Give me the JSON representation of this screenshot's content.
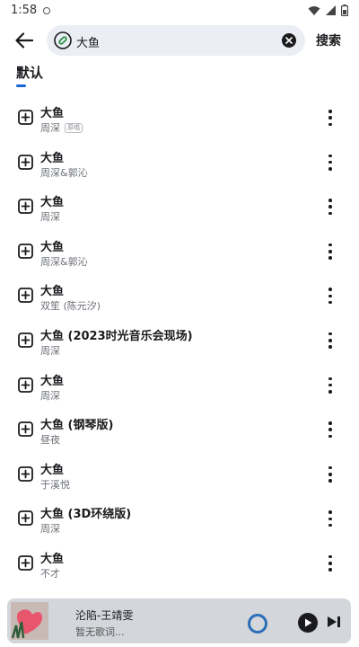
{
  "status_bar": {
    "time": "1:58"
  },
  "search": {
    "query": "大鱼",
    "submit_label": "搜索"
  },
  "tabs": [
    {
      "label": "默认",
      "active": true
    }
  ],
  "results": [
    {
      "title": "大鱼",
      "artist": "周深",
      "badge": "原唱"
    },
    {
      "title": "大鱼",
      "artist": "周深&郭沁"
    },
    {
      "title": "大鱼",
      "artist": "周深"
    },
    {
      "title": "大鱼",
      "artist": "周深&郭沁"
    },
    {
      "title": "大鱼",
      "artist": "双笙 (陈元汐)"
    },
    {
      "title": "大鱼 (2023时光音乐会现场)",
      "artist": "周深"
    },
    {
      "title": "大鱼",
      "artist": "周深"
    },
    {
      "title": "大鱼 (钢琴版)",
      "artist": "昼夜"
    },
    {
      "title": "大鱼",
      "artist": "于溪悦"
    },
    {
      "title": "大鱼 (3D环绕版)",
      "artist": "周深"
    },
    {
      "title": "大鱼",
      "artist": "不才"
    }
  ],
  "player": {
    "title": "沦陷-王靖雯",
    "lyric": "暂无歌词..."
  },
  "colors": {
    "accent": "#1967d2",
    "search_bg": "#ebeef4",
    "player_bg": "#d3d6db"
  },
  "icons": {
    "back": "arrow-left-icon",
    "link": "link-icon",
    "clear": "clear-icon",
    "add": "add-box-icon",
    "more": "more-vert-icon",
    "play": "play-icon",
    "next": "skip-next-icon"
  }
}
